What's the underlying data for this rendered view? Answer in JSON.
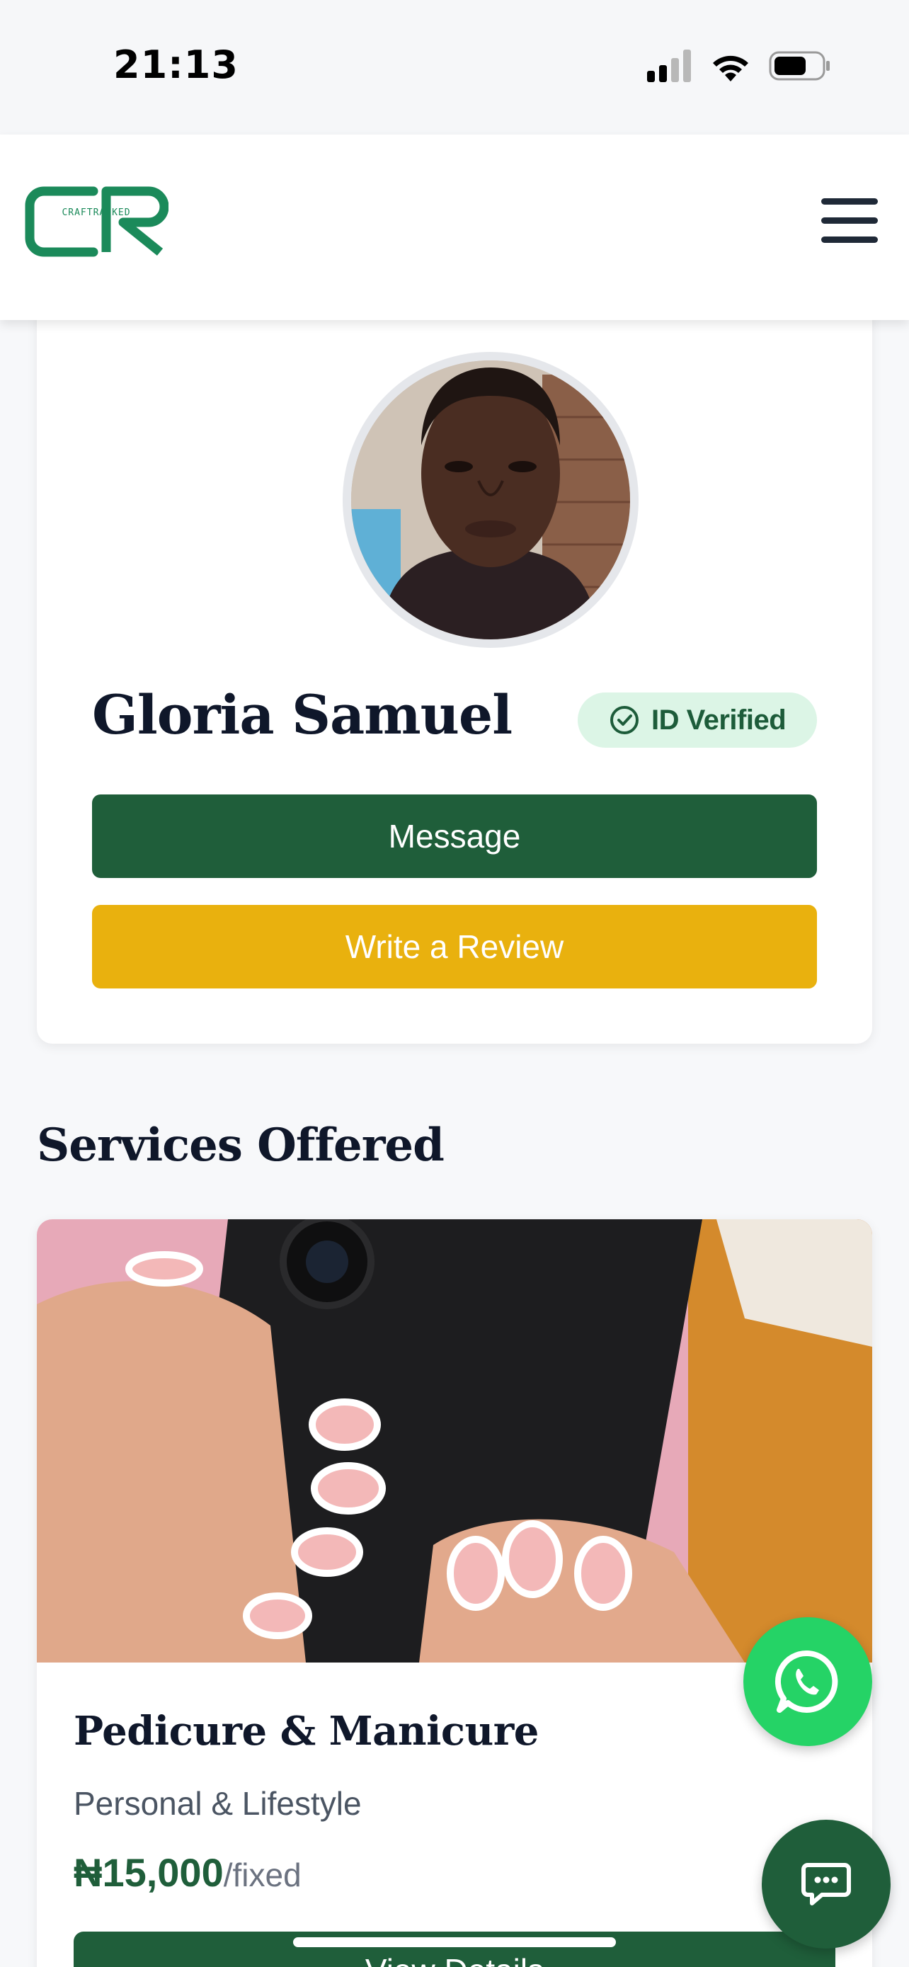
{
  "status_bar": {
    "time": "21:13"
  },
  "header": {
    "logo_text": "CRAFTRANKED"
  },
  "profile": {
    "name": "Gloria Samuel",
    "verified_label": "ID Verified",
    "message_button": "Message",
    "review_button": "Write a Review"
  },
  "services": {
    "title": "Services Offered",
    "items": [
      {
        "name": "Pedicure & Manicure",
        "category": "Personal & Lifestyle",
        "price": "₦15,000",
        "price_unit": "/fixed",
        "details_button": "View Details"
      }
    ]
  },
  "colors": {
    "brand_green": "#1f5e3a",
    "accent_yellow": "#e9b10e",
    "whatsapp_green": "#25d366",
    "verified_bg": "#dcf5e6"
  }
}
